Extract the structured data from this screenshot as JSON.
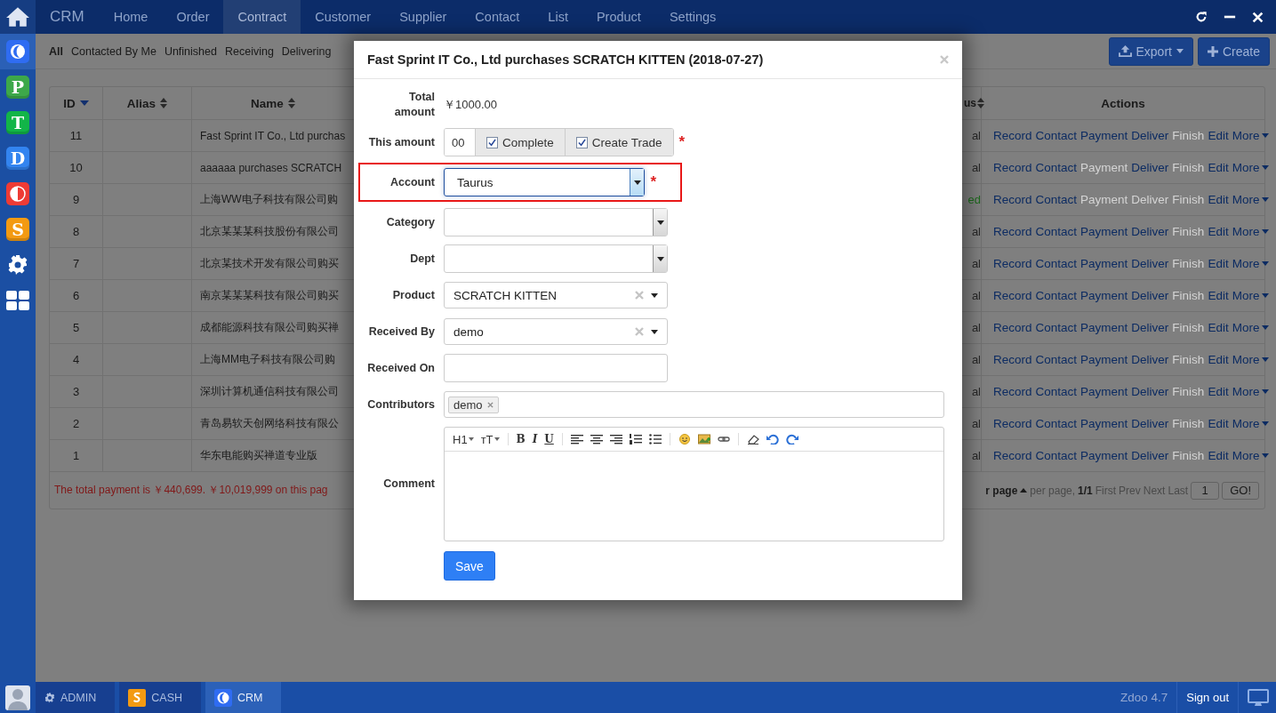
{
  "nav": {
    "brand": "CRM",
    "items": [
      {
        "label": "Home",
        "selected": false
      },
      {
        "label": "Order",
        "selected": false
      },
      {
        "label": "Contract",
        "selected": true
      },
      {
        "label": "Customer",
        "selected": false
      },
      {
        "label": "Supplier",
        "selected": false
      },
      {
        "label": "Contact",
        "selected": false
      },
      {
        "label": "List",
        "selected": false
      },
      {
        "label": "Product",
        "selected": false
      },
      {
        "label": "Settings",
        "selected": false
      }
    ]
  },
  "sidebar": {
    "apps": [
      {
        "kind": "crescent",
        "color": "#2f6cf2",
        "selected": true
      },
      {
        "kind": "letter",
        "text": "P",
        "color": "#3da84a",
        "selected": false
      },
      {
        "kind": "letter",
        "text": "T",
        "color": "#12b548",
        "selected": false
      },
      {
        "kind": "letter",
        "text": "D",
        "color": "#3384f0",
        "selected": false
      },
      {
        "kind": "halfcircle",
        "color": "#ee3b35",
        "selected": false
      },
      {
        "kind": "letter",
        "text": "S",
        "color": "#f39a12",
        "selected": false
      }
    ]
  },
  "filters": [
    {
      "label": "All",
      "selected": true
    },
    {
      "label": "Contacted By Me",
      "selected": false
    },
    {
      "label": "Unfinished",
      "selected": false
    },
    {
      "label": "Receiving",
      "selected": false
    },
    {
      "label": "Delivering",
      "selected": false
    }
  ],
  "actions": [
    {
      "kind": "export",
      "label": "Export"
    },
    {
      "kind": "create",
      "label": "Create"
    }
  ],
  "table": {
    "columns": [
      {
        "label": "ID",
        "sortable": true,
        "sorted": true
      },
      {
        "label": "Alias",
        "sortable": true,
        "sorted": false
      },
      {
        "label": "Name",
        "sortable": true,
        "sorted": false
      },
      {
        "label": "us",
        "sortable": true,
        "sorted": false
      },
      {
        "label": "Actions",
        "sortable": false
      }
    ],
    "rows": [
      {
        "id": "11",
        "name": "Fast Sprint IT Co., Ltd purchas",
        "status": {
          "text": "al",
          "color": "#262626"
        },
        "actions": [
          {
            "label": "Record",
            "disabled": false
          },
          {
            "label": "Contact",
            "disabled": false
          },
          {
            "label": "Payment",
            "disabled": false
          },
          {
            "label": "Deliver",
            "disabled": false
          },
          {
            "label": "Finish",
            "disabled": true
          },
          {
            "label": "Edit",
            "disabled": false
          },
          {
            "label": "More",
            "disabled": false
          }
        ]
      },
      {
        "id": "10",
        "name": "aaaaaa purchases SCRATCH",
        "status": {
          "text": "al",
          "color": "#262626"
        },
        "actions": [
          {
            "label": "Record",
            "disabled": false
          },
          {
            "label": "Contact",
            "disabled": false
          },
          {
            "label": "Payment",
            "disabled": true
          },
          {
            "label": "Deliver",
            "disabled": false
          },
          {
            "label": "Finish",
            "disabled": true
          },
          {
            "label": "Edit",
            "disabled": false
          },
          {
            "label": "More",
            "disabled": false
          }
        ]
      },
      {
        "id": "9",
        "name": "上海WW电子科技有限公司购",
        "status": {
          "text": "ed",
          "color": "#1d6a1d"
        },
        "actions": [
          {
            "label": "Record",
            "disabled": false
          },
          {
            "label": "Contact",
            "disabled": false
          },
          {
            "label": "Payment",
            "disabled": true
          },
          {
            "label": "Deliver",
            "disabled": true
          },
          {
            "label": "Finish",
            "disabled": true
          },
          {
            "label": "Edit",
            "disabled": false
          },
          {
            "label": "More",
            "disabled": false
          }
        ]
      },
      {
        "id": "8",
        "name": "北京某某某科技股份有限公司",
        "status": {
          "text": "al",
          "color": "#262626"
        },
        "actions": [
          {
            "label": "Record",
            "disabled": false
          },
          {
            "label": "Contact",
            "disabled": false
          },
          {
            "label": "Payment",
            "disabled": false
          },
          {
            "label": "Deliver",
            "disabled": false
          },
          {
            "label": "Finish",
            "disabled": true
          },
          {
            "label": "Edit",
            "disabled": false
          },
          {
            "label": "More",
            "disabled": false
          }
        ]
      },
      {
        "id": "7",
        "name": "北京某技术开发有限公司购买",
        "status": {
          "text": "al",
          "color": "#262626"
        },
        "actions": [
          {
            "label": "Record",
            "disabled": false
          },
          {
            "label": "Contact",
            "disabled": false
          },
          {
            "label": "Payment",
            "disabled": false
          },
          {
            "label": "Deliver",
            "disabled": false
          },
          {
            "label": "Finish",
            "disabled": true
          },
          {
            "label": "Edit",
            "disabled": false
          },
          {
            "label": "More",
            "disabled": false
          }
        ]
      },
      {
        "id": "6",
        "name": "南京某某某科技有限公司购买",
        "status": {
          "text": "al",
          "color": "#262626"
        },
        "actions": [
          {
            "label": "Record",
            "disabled": false
          },
          {
            "label": "Contact",
            "disabled": false
          },
          {
            "label": "Payment",
            "disabled": false
          },
          {
            "label": "Deliver",
            "disabled": false
          },
          {
            "label": "Finish",
            "disabled": true
          },
          {
            "label": "Edit",
            "disabled": false
          },
          {
            "label": "More",
            "disabled": false
          }
        ]
      },
      {
        "id": "5",
        "name": "成都能源科技有限公司购买禅",
        "status": {
          "text": "al",
          "color": "#262626"
        },
        "actions": [
          {
            "label": "Record",
            "disabled": false
          },
          {
            "label": "Contact",
            "disabled": false
          },
          {
            "label": "Payment",
            "disabled": false
          },
          {
            "label": "Deliver",
            "disabled": false
          },
          {
            "label": "Finish",
            "disabled": true
          },
          {
            "label": "Edit",
            "disabled": false
          },
          {
            "label": "More",
            "disabled": false
          }
        ]
      },
      {
        "id": "4",
        "name": "上海MM电子科技有限公司购",
        "status": {
          "text": "al",
          "color": "#262626"
        },
        "actions": [
          {
            "label": "Record",
            "disabled": false
          },
          {
            "label": "Contact",
            "disabled": false
          },
          {
            "label": "Payment",
            "disabled": false
          },
          {
            "label": "Deliver",
            "disabled": false
          },
          {
            "label": "Finish",
            "disabled": true
          },
          {
            "label": "Edit",
            "disabled": false
          },
          {
            "label": "More",
            "disabled": false
          }
        ]
      },
      {
        "id": "3",
        "name": "深圳计算机通信科技有限公司",
        "status": {
          "text": "al",
          "color": "#262626"
        },
        "actions": [
          {
            "label": "Record",
            "disabled": false
          },
          {
            "label": "Contact",
            "disabled": false
          },
          {
            "label": "Payment",
            "disabled": false
          },
          {
            "label": "Deliver",
            "disabled": false
          },
          {
            "label": "Finish",
            "disabled": true
          },
          {
            "label": "Edit",
            "disabled": false
          },
          {
            "label": "More",
            "disabled": false
          }
        ]
      },
      {
        "id": "2",
        "name": "青岛易软天创网络科技有限公",
        "status": {
          "text": "al",
          "color": "#262626"
        },
        "actions": [
          {
            "label": "Record",
            "disabled": false
          },
          {
            "label": "Contact",
            "disabled": false
          },
          {
            "label": "Payment",
            "disabled": false
          },
          {
            "label": "Deliver",
            "disabled": false
          },
          {
            "label": "Finish",
            "disabled": true
          },
          {
            "label": "Edit",
            "disabled": false
          },
          {
            "label": "More",
            "disabled": false
          }
        ]
      },
      {
        "id": "1",
        "name": "华东电能购买禅道专业版",
        "status": {
          "text": "al",
          "color": "#262626"
        },
        "actions": [
          {
            "label": "Record",
            "disabled": false
          },
          {
            "label": "Contact",
            "disabled": false
          },
          {
            "label": "Payment",
            "disabled": false
          },
          {
            "label": "Deliver",
            "disabled": false
          },
          {
            "label": "Finish",
            "disabled": true
          },
          {
            "label": "Edit",
            "disabled": false
          },
          {
            "label": "More",
            "disabled": false
          }
        ]
      }
    ],
    "footer": {
      "summary": "The total payment is ￥440,699. ￥10,019,999 on this pag",
      "per_page": "r page",
      "per_page_text": "per page,",
      "page_info": "1/1",
      "links": [
        "First",
        "Prev",
        "Next",
        "Last"
      ],
      "page_input": "1",
      "go": "GO!"
    }
  },
  "modal": {
    "title": "Fast Sprint IT Co., Ltd purchases SCRATCH KITTEN (2018-07-27)",
    "fields": [
      {
        "kind": "static",
        "label": "Total amount",
        "value": "￥1000.00"
      },
      {
        "kind": "amount",
        "label": "This amount",
        "value": "00",
        "checks": [
          {
            "label": "Complete",
            "checked": true
          },
          {
            "label": "Create Trade",
            "checked": true
          }
        ],
        "required_mark": "*"
      },
      {
        "kind": "select",
        "label": "Account",
        "value": "Taurus",
        "focused": true,
        "highlighted": true,
        "required_mark": "*"
      },
      {
        "kind": "select",
        "label": "Category",
        "focused": false,
        "highlighted": false
      },
      {
        "kind": "select",
        "label": "Dept",
        "focused": false,
        "highlighted": false
      },
      {
        "kind": "chosen",
        "label": "Product",
        "value": "SCRATCH KITTEN"
      },
      {
        "kind": "chosen",
        "label": "Received By",
        "value": "demo"
      },
      {
        "kind": "input",
        "label": "Received On"
      },
      {
        "kind": "tags",
        "label": "Contributors",
        "tags": [
          "demo"
        ]
      },
      {
        "kind": "editor",
        "label": "Comment",
        "toolbar": {
          "heading": "H1",
          "size": "ᴛT",
          "bold": "B",
          "italic": "I",
          "underline": "U"
        }
      }
    ],
    "save": "Save"
  },
  "taskbar": {
    "apps": [
      {
        "kind": "gear",
        "label": "ADMIN",
        "selected": false
      },
      {
        "kind": "cash",
        "label": "CASH",
        "selected": false
      },
      {
        "kind": "crm",
        "label": "CRM",
        "selected": true
      }
    ],
    "version": "Zdoo 4.7",
    "signout": "Sign out"
  }
}
